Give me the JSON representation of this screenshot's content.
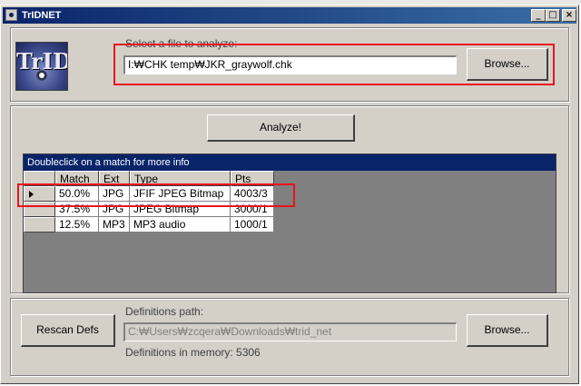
{
  "window": {
    "title": "TrIDNET"
  },
  "title_buttons": {
    "minimize": "_",
    "maximize": "□",
    "close": "×"
  },
  "logo": {
    "text": "TrID"
  },
  "file_select": {
    "label": "Select a file to analyze:",
    "path": "I:₩CHK temp₩JKR_graywolf.chk",
    "browse_label": "Browse..."
  },
  "analyze": {
    "label": "Analyze!"
  },
  "results": {
    "caption": "Doubleclick on a match for more info",
    "columns": [
      "Match",
      "Ext",
      "Type",
      "Pts"
    ],
    "rows": [
      {
        "match": "50.0%",
        "ext": "JPG",
        "type": "JFIF JPEG Bitmap",
        "pts": "4003/3",
        "selected": true
      },
      {
        "match": "37.5%",
        "ext": "JPG",
        "type": "JPEG Bitmap",
        "pts": "3000/1",
        "selected": false
      },
      {
        "match": "12.5%",
        "ext": "MP3",
        "type": "MP3 audio",
        "pts": "1000/1",
        "selected": false
      }
    ]
  },
  "definitions": {
    "rescan_label": "Rescan Defs",
    "path_label": "Definitions path:",
    "path": "C:₩Users₩zcqera₩Downloads₩trid_net",
    "browse_label": "Browse...",
    "memory_label": "Definitions in memory: 5306"
  },
  "colors": {
    "titlebar": "#0a246a",
    "face": "#d4d0c8",
    "annotation": "#e8141c",
    "grid_background": "#808080"
  }
}
